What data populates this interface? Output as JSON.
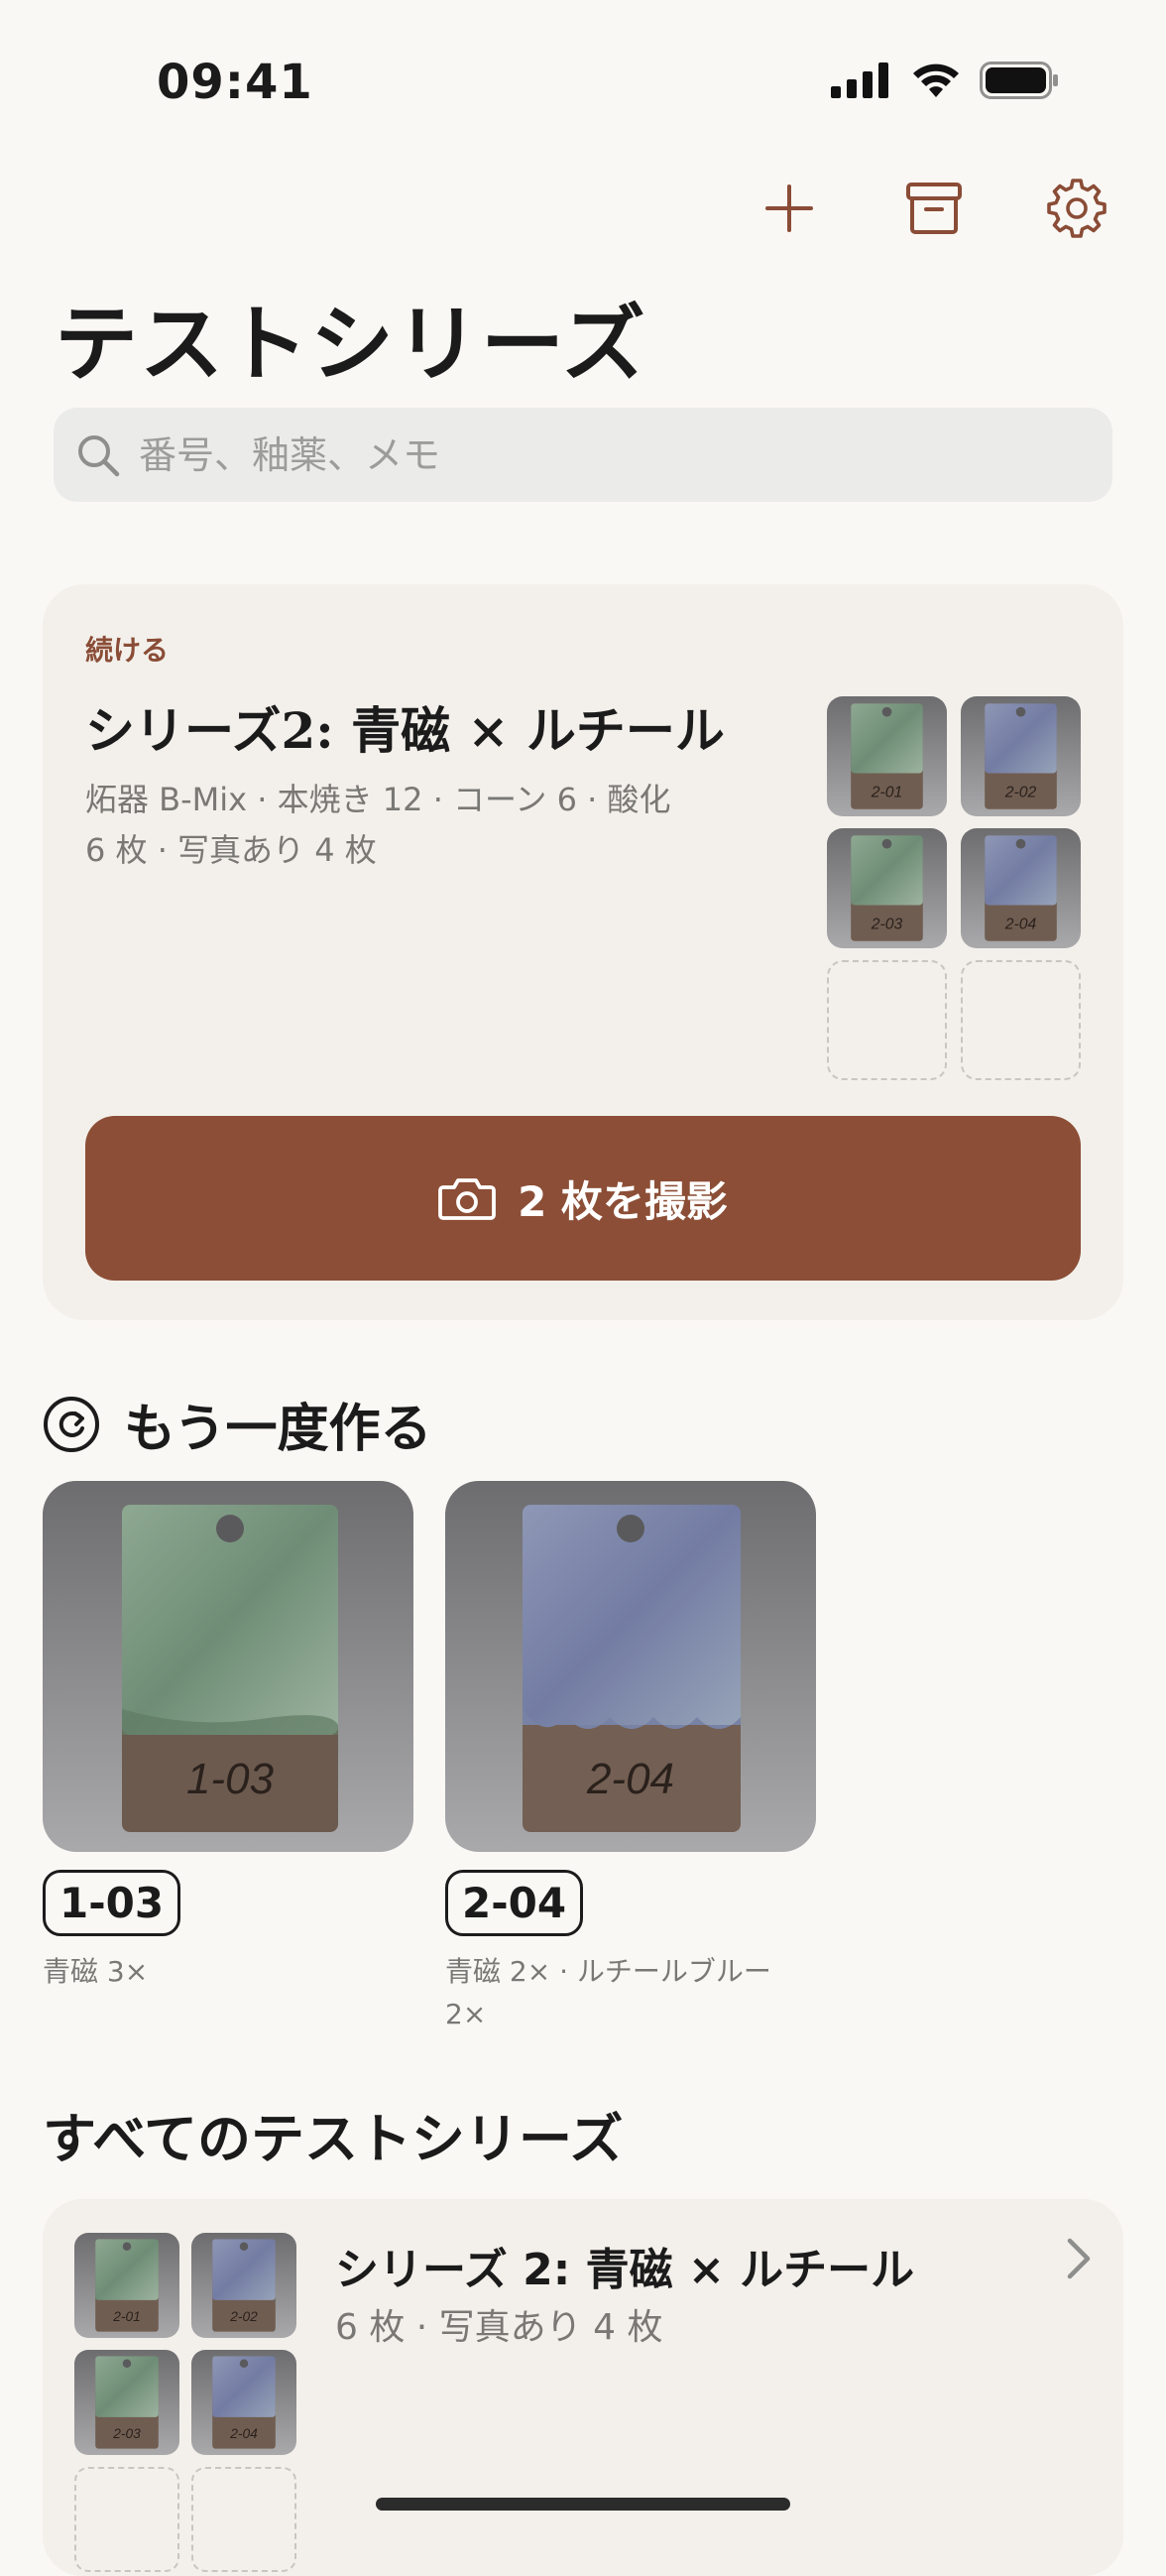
{
  "status_bar": {
    "time": "09:41"
  },
  "toolbar": {
    "add_icon": "plus-icon",
    "archive_icon": "archive-box-icon",
    "settings_icon": "gear-icon"
  },
  "title": "テストシリーズ",
  "search": {
    "placeholder": "番号、釉薬、メモ",
    "value": ""
  },
  "continue_card": {
    "kicker": "続ける",
    "title": "シリーズ2: 青磁 × ルチール",
    "meta": "炻器 B-Mix · 本焼き 12 · コーン 6 · 酸化",
    "count": "6 枚 · 写真あり 4 枚",
    "tiles": [
      {
        "label": "2-01",
        "glaze": "green"
      },
      {
        "label": "2-02",
        "glaze": "blue"
      },
      {
        "label": "2-03",
        "glaze": "green"
      },
      {
        "label": "2-04",
        "glaze": "blue"
      }
    ],
    "empty_slots": 2,
    "button_label": "2 枚を撮影",
    "button_icon": "camera-icon"
  },
  "remake": {
    "heading": "もう一度作る",
    "icon": "repeat-icon",
    "items": [
      {
        "badge": "1-03",
        "desc": "青磁 3×",
        "glaze": "green"
      },
      {
        "badge": "2-04",
        "desc": "青磁 2× · ルチールブルー 2×",
        "glaze": "blue"
      }
    ]
  },
  "all_series": {
    "heading": "すべてのテストシリーズ",
    "items": [
      {
        "title": "シリーズ 2: 青磁 × ルチール",
        "meta": "6 枚 · 写真あり 4 枚",
        "tiles": [
          {
            "label": "2-01",
            "glaze": "green"
          },
          {
            "label": "2-02",
            "glaze": "blue"
          },
          {
            "label": "2-03",
            "glaze": "green"
          },
          {
            "label": "2-04",
            "glaze": "blue"
          }
        ]
      }
    ]
  },
  "colors": {
    "accent": "#8c4e36",
    "background": "#faf8f5",
    "card": "#f3f0eb",
    "celadon": "#7f9a86",
    "rutile_blue": "#7f86a6",
    "clay": "#7a6558"
  }
}
